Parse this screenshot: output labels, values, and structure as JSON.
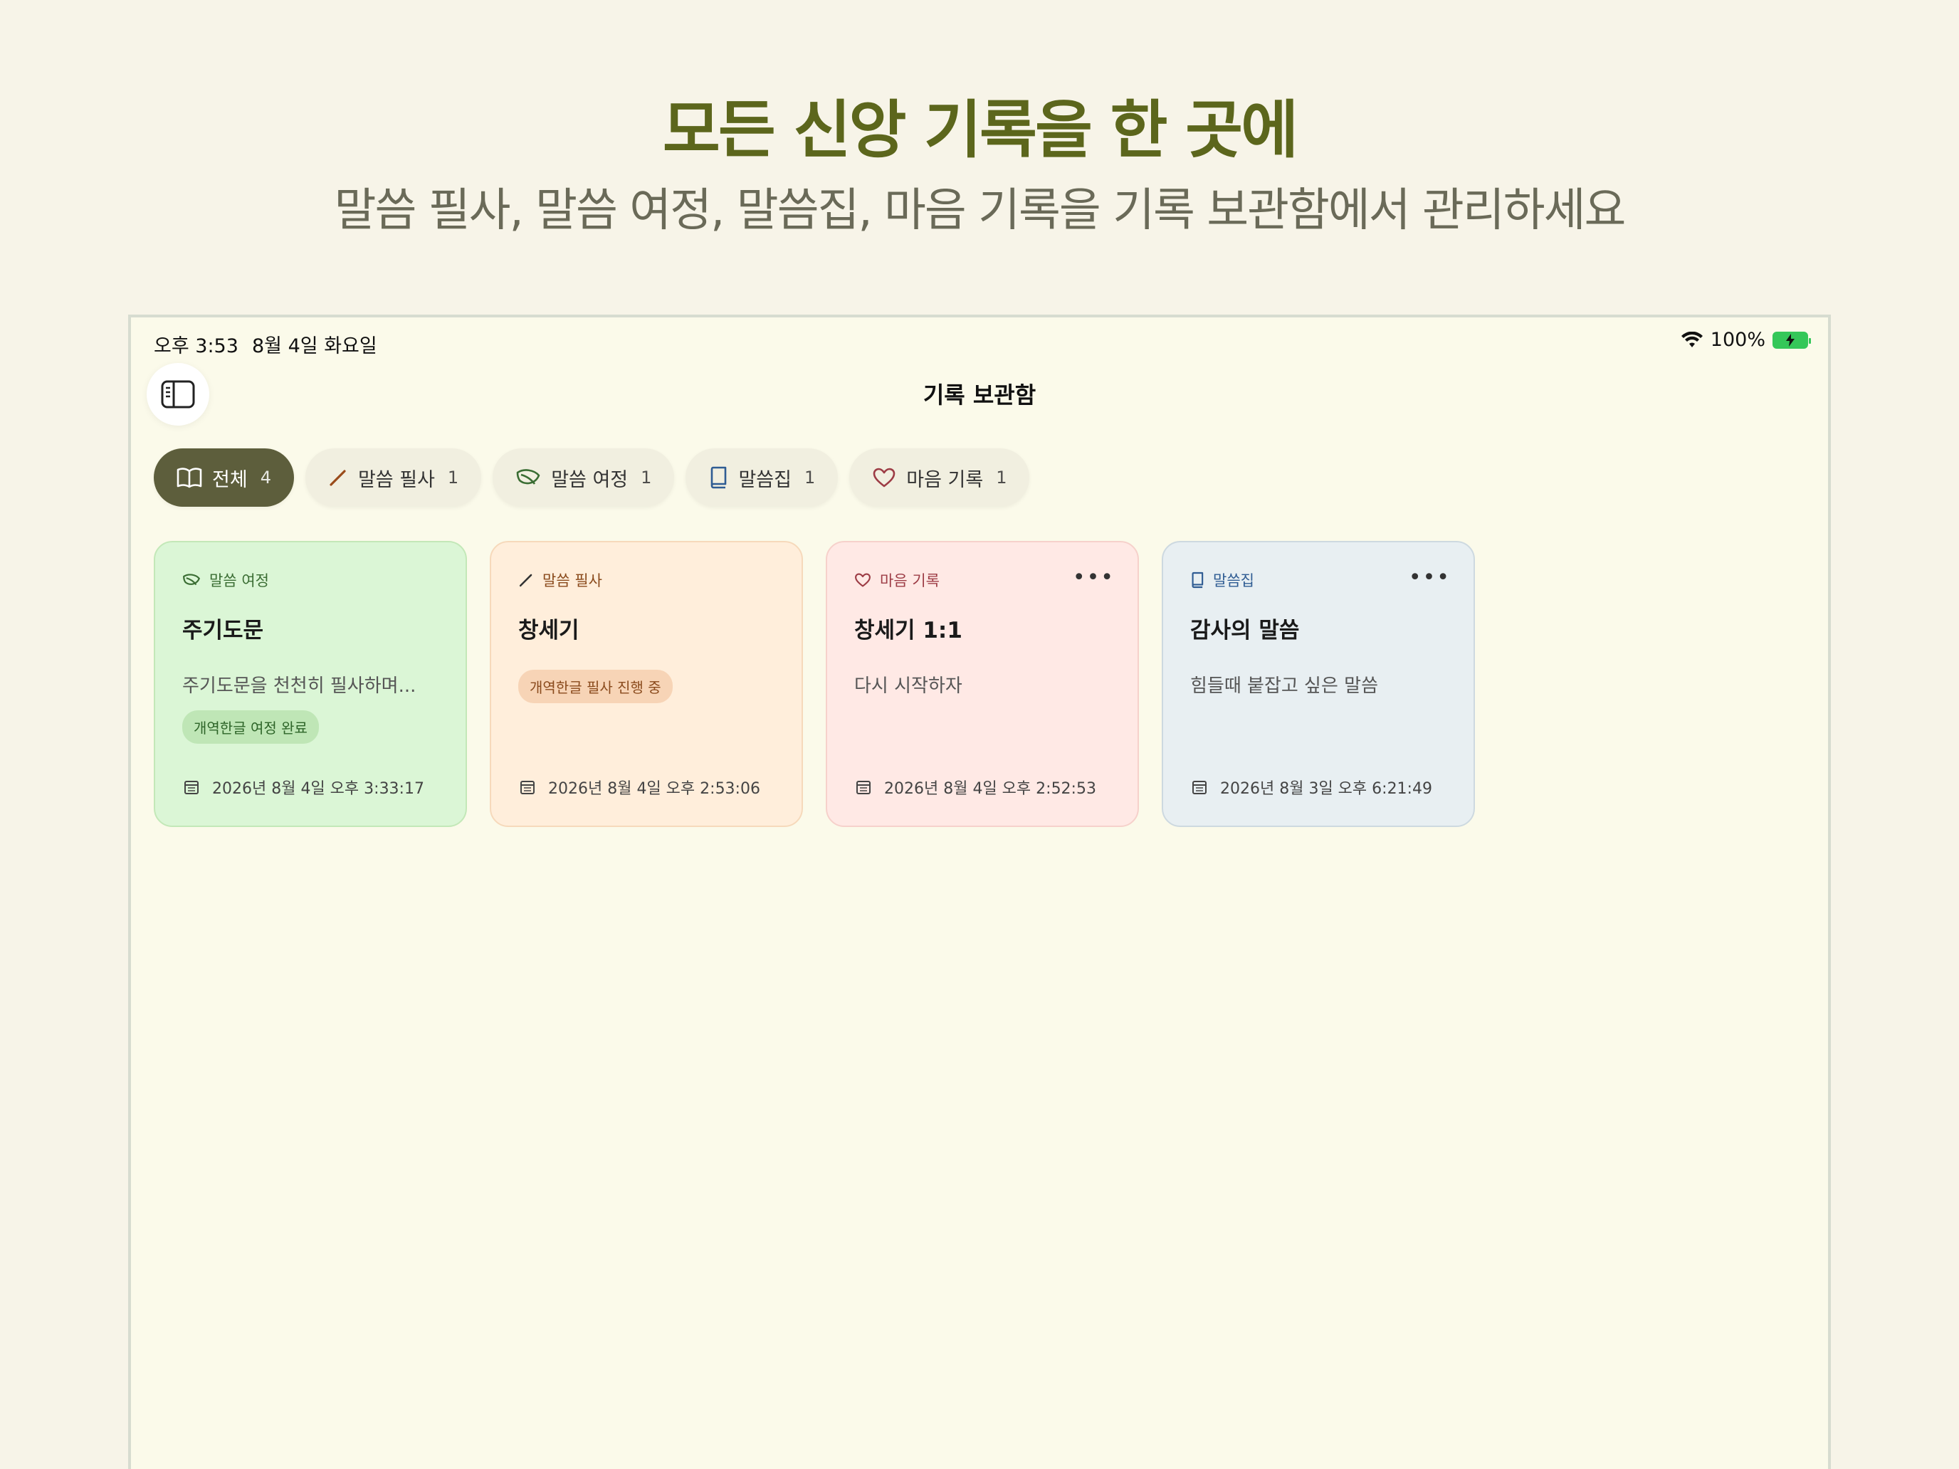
{
  "hero": {
    "title": "모든 신앙 기록을 한 곳에",
    "subtitle": "말씀 필사, 말씀 여정, 말씀집, 마음 기록을 기록 보관함에서 관리하세요"
  },
  "status_bar": {
    "time": "오후 3:53",
    "date": "8월 4일 화요일",
    "battery": "100%"
  },
  "nav": {
    "title": "기록 보관함"
  },
  "filters": [
    {
      "label": "전체",
      "count": "4",
      "icon": "book-open-icon",
      "active": true
    },
    {
      "label": "말씀 필사",
      "count": "1",
      "icon": "pencil-icon",
      "active": false
    },
    {
      "label": "말씀 여정",
      "count": "1",
      "icon": "leaf-icon",
      "active": false
    },
    {
      "label": "말씀집",
      "count": "1",
      "icon": "book-icon",
      "active": false
    },
    {
      "label": "마음 기록",
      "count": "1",
      "icon": "heart-icon",
      "active": false
    }
  ],
  "cards": [
    {
      "category": "말씀 여정",
      "icon": "leaf-icon",
      "title": "주기도문",
      "description": "주기도문을 천천히 필사하며...",
      "badge": "개역한글 여정 완료",
      "date": "2026년 8월 4일 오후 3:33:17",
      "color": "#dbf6d6"
    },
    {
      "category": "말씀 필사",
      "icon": "pencil-icon",
      "title": "창세기",
      "badge": "개역한글 필사 진행 중",
      "date": "2026년 8월 4일 오후 2:53:06",
      "color": "#ffeedb"
    },
    {
      "category": "마음 기록",
      "icon": "heart-icon",
      "title": "창세기 1:1",
      "description": "다시 시작하자",
      "date": "2026년 8월 4일 오후 2:52:53",
      "color": "#ffe9e5"
    },
    {
      "category": "말씀집",
      "icon": "book-icon",
      "title": "감사의 말씀",
      "description": "힘들때 붙잡고 싶은 말씀",
      "date": "2026년 8월 3일 오후 6:21:49",
      "color": "#e8eff2"
    }
  ]
}
